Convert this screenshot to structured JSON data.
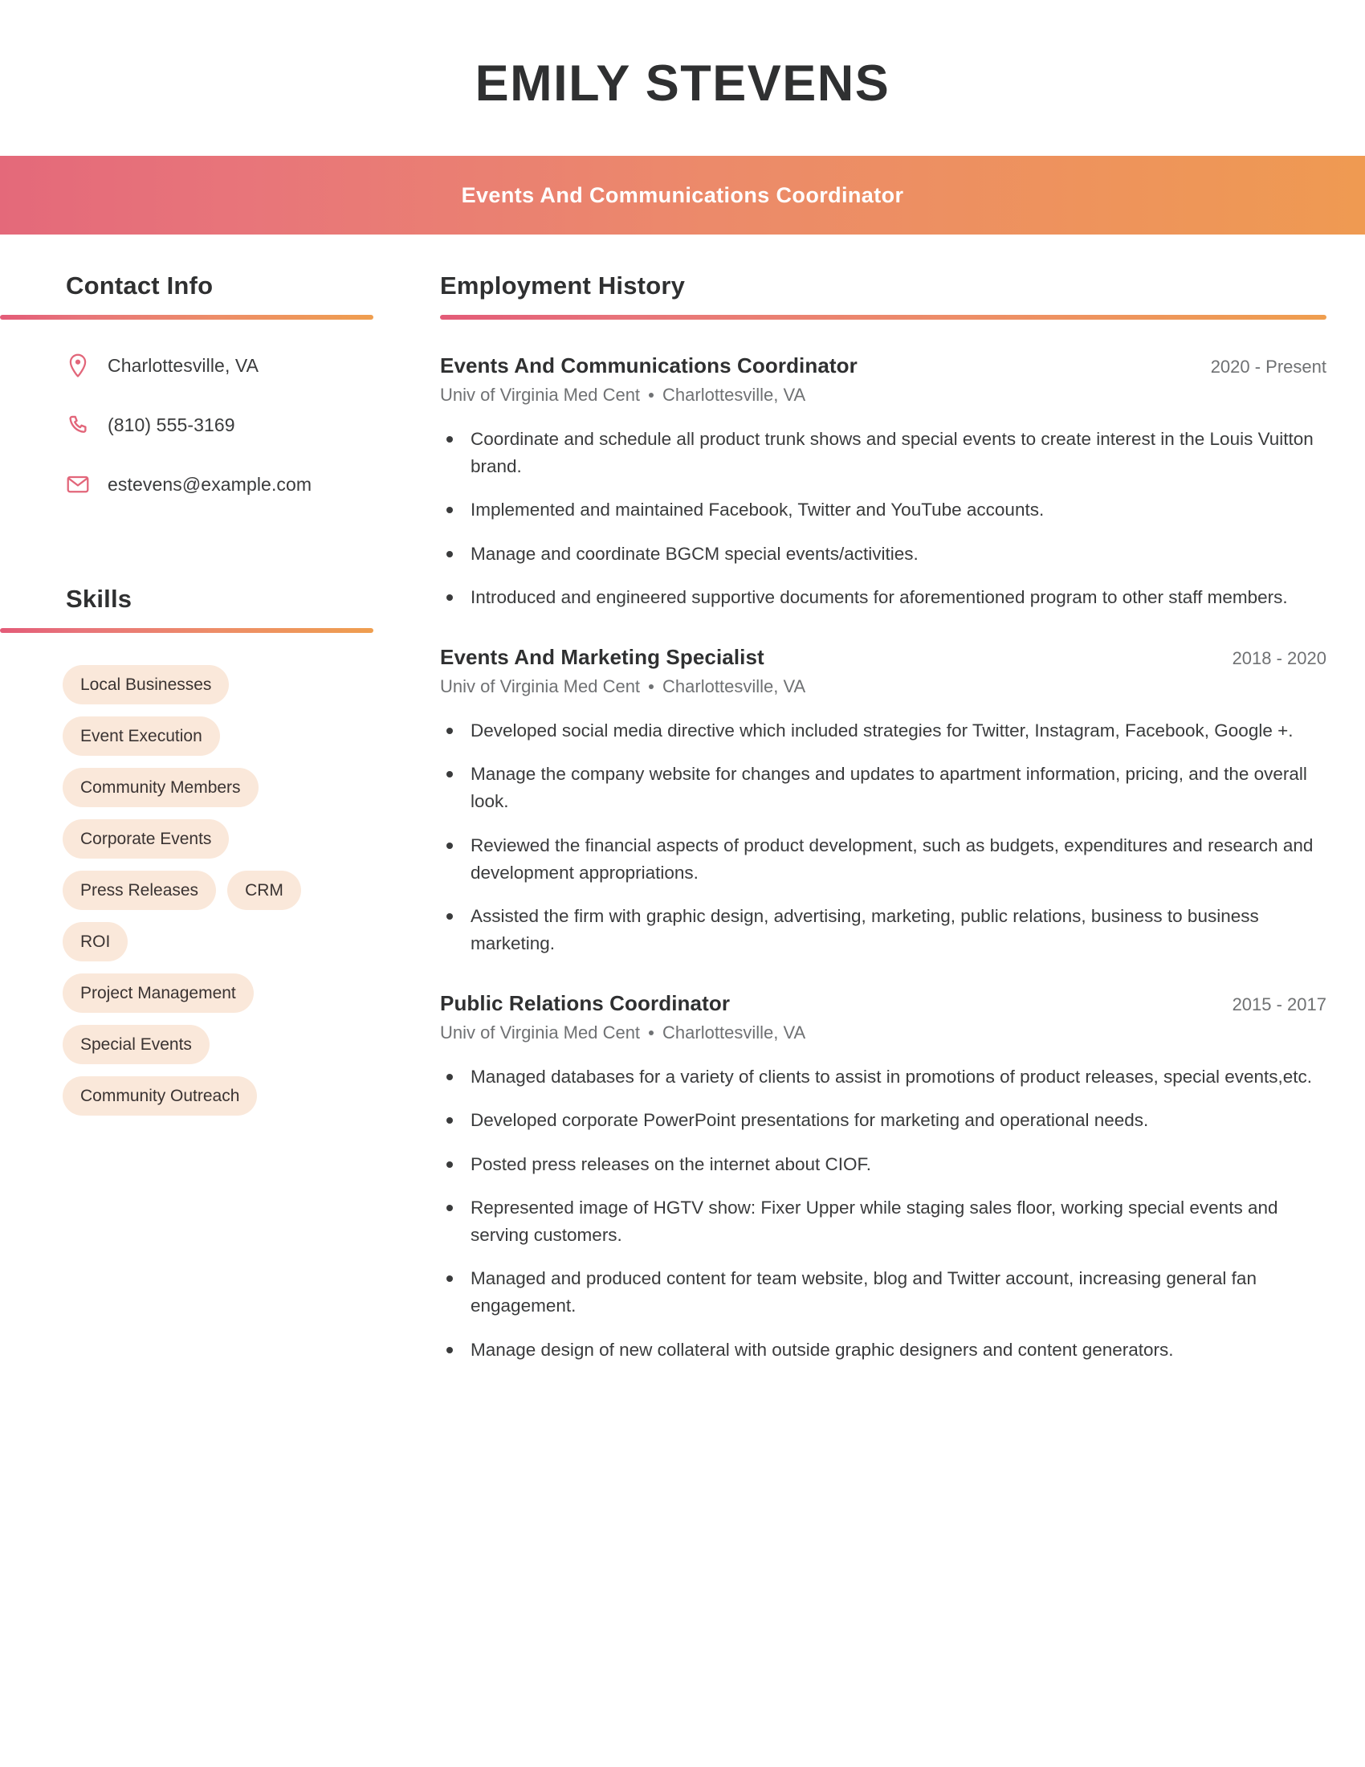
{
  "theme": {
    "gradient_start": "#e4697a",
    "gradient_end": "#ef9a52",
    "accent_icon": "#e2667a",
    "skill_tag_bg": "#fae8da",
    "heading_color": "#2f3031",
    "body_color": "#3a3b3c",
    "muted_color": "#6f7173"
  },
  "header": {
    "name": "EMILY STEVENS",
    "title": "Events And Communications Coordinator"
  },
  "contact": {
    "heading": "Contact Info",
    "items": [
      {
        "icon": "location-pin-icon",
        "value": "Charlottesville, VA"
      },
      {
        "icon": "phone-icon",
        "value": "(810) 555-3169"
      },
      {
        "icon": "envelope-icon",
        "value": "estevens@example.com"
      }
    ]
  },
  "skills": {
    "heading": "Skills",
    "tags": [
      "Local Businesses",
      "Event Execution",
      "Community Members",
      "Corporate Events",
      "Press Releases",
      "CRM",
      "ROI",
      "Project Management",
      "Special Events",
      "Community Outreach"
    ]
  },
  "employment": {
    "heading": "Employment History",
    "jobs": [
      {
        "title": "Events And Communications Coordinator",
        "dates": "2020 - Present",
        "company": "Univ of Virginia Med Cent",
        "location": "Charlottesville, VA",
        "bullets": [
          "Coordinate and schedule all product trunk shows and special events to create interest in the Louis Vuitton brand.",
          "Implemented and maintained Facebook, Twitter and YouTube accounts.",
          "Manage and coordinate BGCM special events/activities.",
          "Introduced and engineered supportive documents for aforementioned program to other staff members."
        ]
      },
      {
        "title": "Events And Marketing Specialist",
        "dates": "2018 - 2020",
        "company": "Univ of Virginia Med Cent",
        "location": "Charlottesville, VA",
        "bullets": [
          "Developed social media directive which included strategies for Twitter, Instagram, Facebook, Google +.",
          "Manage the company website for changes and updates to apartment information, pricing, and the overall look.",
          "Reviewed the financial aspects of product development, such as budgets, expenditures and research and development appropriations.",
          "Assisted the firm with graphic design, advertising, marketing, public relations, business to business marketing."
        ]
      },
      {
        "title": "Public Relations Coordinator",
        "dates": "2015 - 2017",
        "company": "Univ of Virginia Med Cent",
        "location": "Charlottesville, VA",
        "bullets": [
          "Managed databases for a variety of clients to assist in promotions of product releases, special events,etc.",
          "Developed corporate PowerPoint presentations for marketing and operational needs.",
          "Posted press releases on the internet about CIOF.",
          "Represented image of HGTV show: Fixer Upper while staging sales floor, working special events and serving customers.",
          "Managed and produced content for team website, blog and Twitter account, increasing general fan engagement.",
          "Manage design of new collateral with outside graphic designers and content generators."
        ]
      }
    ]
  }
}
